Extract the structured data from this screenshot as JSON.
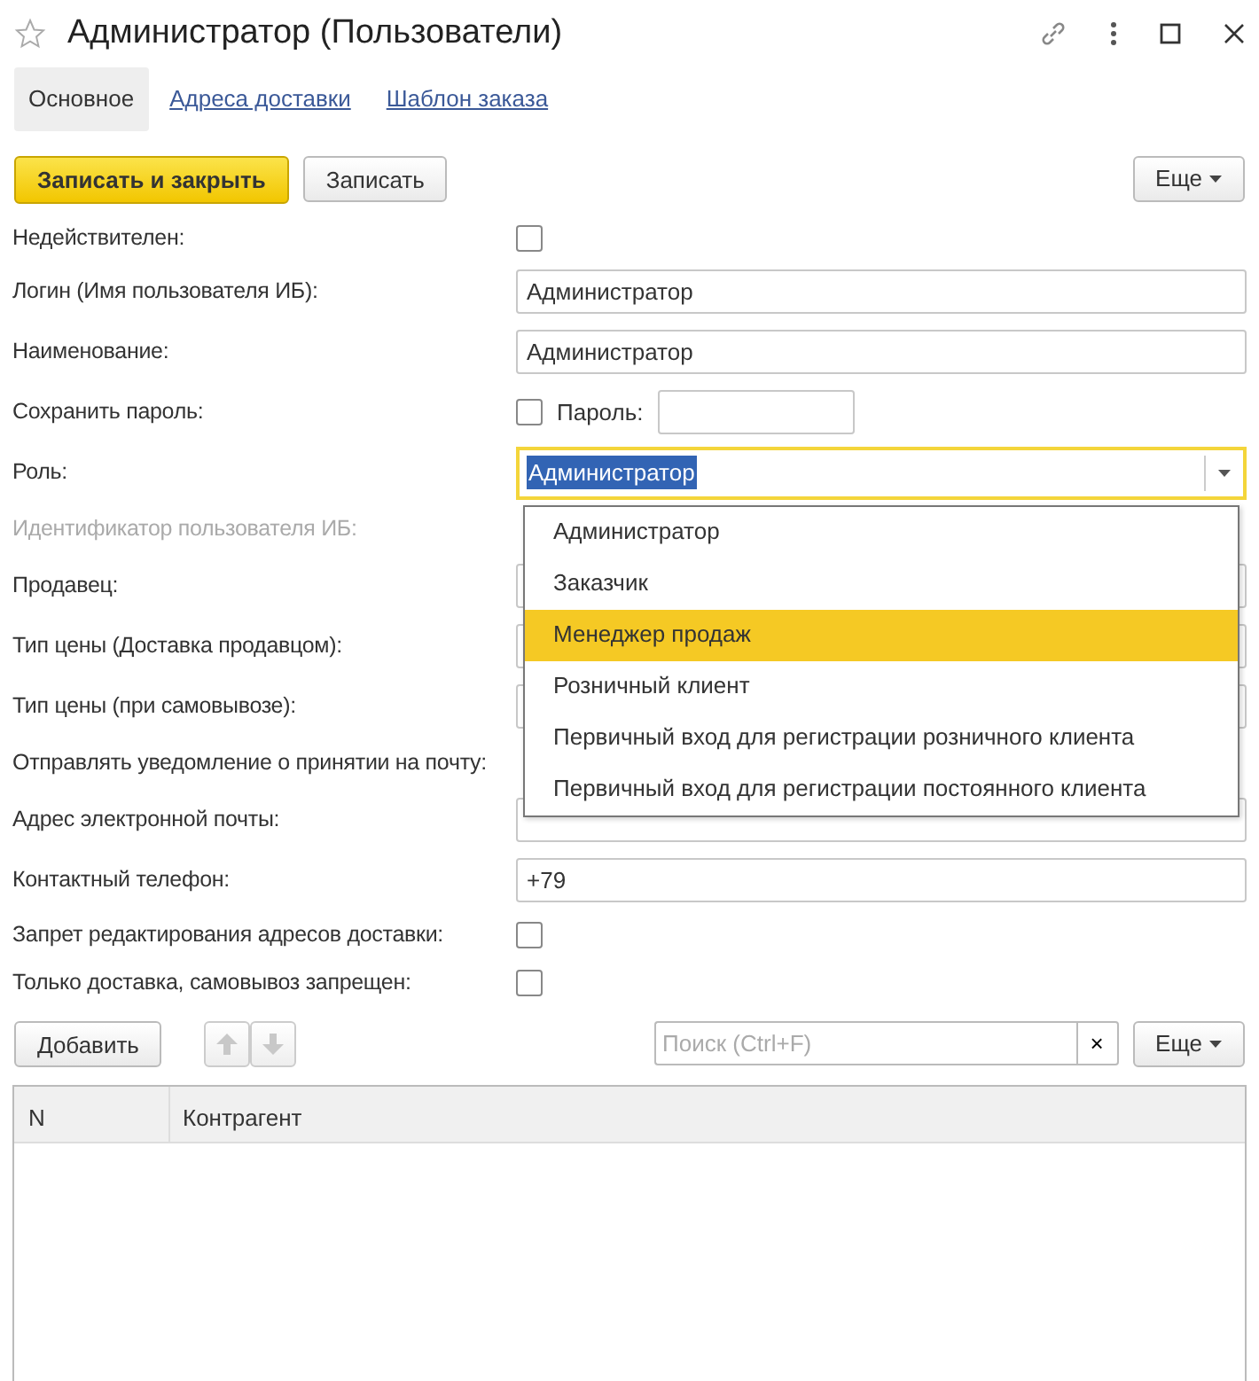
{
  "window": {
    "title": "Администратор (Пользователи)",
    "favorite": false
  },
  "tabs": [
    {
      "label": "Основное",
      "selected": true
    },
    {
      "label": "Адреса доставки",
      "selected": false
    },
    {
      "label": "Шаблон заказа",
      "selected": false
    }
  ],
  "toolbar": {
    "buttons": [
      {
        "label": "Записать и закрыть",
        "kind": "primary"
      },
      {
        "label": "Записать",
        "kind": "default"
      }
    ],
    "more": "Еще"
  },
  "fields": [
    {
      "label": "Недействителен:",
      "kind": "checkbox",
      "checked": false
    },
    {
      "label": "Логин (Имя пользователя ИБ):",
      "kind": "input",
      "value": "Администратор"
    },
    {
      "label": "Наименование:",
      "kind": "input",
      "value": "Администратор"
    },
    {
      "label": "Сохранить пароль:",
      "kind": "password",
      "checked": false,
      "password_label": "Пароль:"
    },
    {
      "label": "Роль:",
      "kind": "select",
      "value": "Администратор",
      "expanded": true
    },
    {
      "label": "Идентификатор пользователя ИБ:",
      "kind": "none",
      "disabled": true
    },
    {
      "label": "Продавец:",
      "kind": "input"
    },
    {
      "label": "Тип цены (Доставка продавцом):",
      "kind": "input"
    },
    {
      "label": "Тип цены (при самовывозе):",
      "kind": "input"
    },
    {
      "label": "Отправлять уведомление о принятии на почту:",
      "kind": "none"
    },
    {
      "label": "Адрес электронной почты:",
      "kind": "input"
    },
    {
      "label": "Контактный телефон:",
      "kind": "input",
      "value": "+79"
    },
    {
      "label": "Запрет редактирования адресов доставки:",
      "kind": "checkbox",
      "checked": false
    },
    {
      "label": "Только доставка, самовывоз запрещен:",
      "kind": "checkbox",
      "checked": false
    }
  ],
  "role_options": [
    {
      "label": "Администратор",
      "selected": false
    },
    {
      "label": "Заказчик",
      "selected": false
    },
    {
      "label": "Менеджер продаж",
      "selected": true
    },
    {
      "label": "Розничный клиент",
      "selected": false
    },
    {
      "label": "Первичный вход для регистрации розничного клиента",
      "selected": false
    },
    {
      "label": "Первичный вход для регистрации постоянного клиента",
      "selected": false
    }
  ],
  "table_toolbar": {
    "add": "Добавить",
    "search_placeholder": "Поиск (Ctrl+F)",
    "clear": "×",
    "more": "Еще"
  },
  "table": {
    "columns": [
      "N",
      "Контрагент"
    ]
  }
}
